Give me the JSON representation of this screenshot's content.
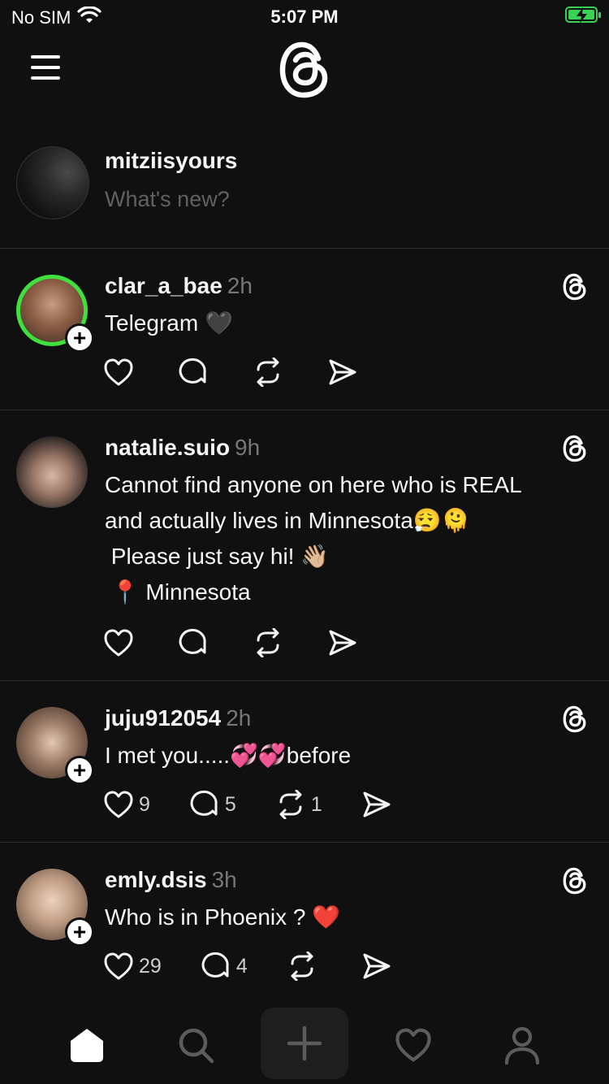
{
  "status_bar": {
    "carrier": "No SIM",
    "time": "5:07 PM",
    "battery_color": "#39d353"
  },
  "header": {
    "menu_icon": "hamburger-icon",
    "logo": "threads-logo"
  },
  "composer": {
    "username": "mitziisyours",
    "placeholder": "What's new?"
  },
  "posts": [
    {
      "username": "clar_a_bae",
      "time": "2h",
      "lines": [
        "Telegram 🖤"
      ],
      "likes": "",
      "replies": "",
      "reposts": ""
    },
    {
      "username": "natalie.suio",
      "time": "9h",
      "lines": [
        "Cannot find anyone on here who is REAL",
        "and actually lives in Minnesota😮‍💨🫠",
        " Please just say hi! 👋🏼",
        " 📍 Minnesota"
      ],
      "likes": "",
      "replies": "",
      "reposts": ""
    },
    {
      "username": "juju912054",
      "time": "2h",
      "lines": [
        "I met you.....💞💞before"
      ],
      "likes": "9",
      "replies": "5",
      "reposts": "1"
    },
    {
      "username": "emly.dsis",
      "time": "3h",
      "lines": [
        "Who is in Phoenix ? ❤️"
      ],
      "likes": "29",
      "replies": "4",
      "reposts": ""
    }
  ],
  "tabbar": {
    "items": [
      "home-icon",
      "search-icon",
      "create-icon",
      "activity-icon",
      "profile-icon"
    ]
  }
}
